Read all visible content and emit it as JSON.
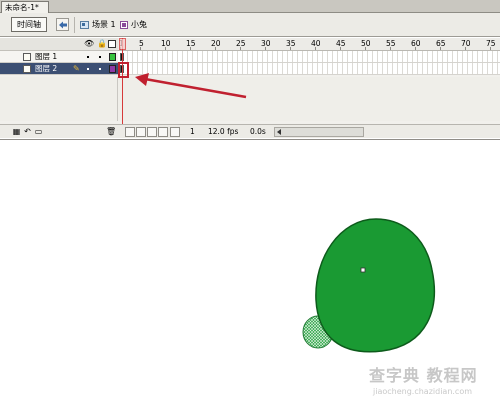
{
  "document": {
    "tab_title": "未命名-1*"
  },
  "toolbar": {
    "timeline_button": "时间轴",
    "scene_label": "场景 1",
    "symbol_label": "小兔"
  },
  "timeline": {
    "ruler_numbers": [
      "1",
      "5",
      "10",
      "15",
      "20",
      "25",
      "30",
      "35",
      "40",
      "45",
      "50",
      "55",
      "60",
      "65",
      "70",
      "75"
    ],
    "layers": [
      {
        "name": "图层 1",
        "color": "#37c43f",
        "selected": false
      },
      {
        "name": "图层 2",
        "color": "#8e39a6",
        "selected": true
      }
    ],
    "current_frame": "1",
    "frame_rate": "12.0 fps",
    "elapsed_time": "0.0s"
  },
  "stage": {
    "shape_fill": "#1a9a33",
    "shape_stroke": "#0d5b1b"
  },
  "colors": {
    "playhead": "#d63a3a",
    "annotation_arrow": "#c0202f",
    "selected_layer_bg": "#3c4f73"
  },
  "watermark": {
    "text": "查字典 教程网",
    "url": "jiaocheng.chazidian.com"
  }
}
